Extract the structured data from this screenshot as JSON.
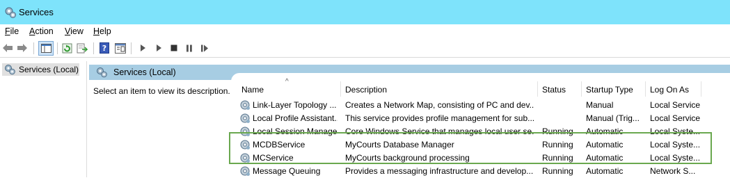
{
  "window": {
    "title": "Services"
  },
  "menu": [
    {
      "key": "file",
      "label": "File"
    },
    {
      "key": "action",
      "label": "Action"
    },
    {
      "key": "view",
      "label": "View"
    },
    {
      "key": "help",
      "label": "Help"
    }
  ],
  "tree": {
    "selected_label": "Services (Local)"
  },
  "panel": {
    "title": "Services (Local)",
    "description_hint": "Select an item to view its description."
  },
  "columns": {
    "name": "Name",
    "description": "Description",
    "status": "Status",
    "startup_type": "Startup Type",
    "log_on_as": "Log On As"
  },
  "services": [
    {
      "name": "Link-Layer Topology ...",
      "description": "Creates a Network Map, consisting of PC and dev...",
      "status": "",
      "startup_type": "Manual",
      "log_on_as": "Local Service"
    },
    {
      "name": "Local Profile Assistant...",
      "description": "This service provides profile management for sub...",
      "status": "",
      "startup_type": "Manual (Trig...",
      "log_on_as": "Local Service"
    },
    {
      "name": "Local Session Manager",
      "description": "Core Windows Service that manages local user se...",
      "status": "Running",
      "startup_type": "Automatic",
      "log_on_as": "Local Syste..."
    },
    {
      "name": "MCDBService",
      "description": "MyCourts Database Manager",
      "status": "Running",
      "startup_type": "Automatic",
      "log_on_as": "Local Syste..."
    },
    {
      "name": "MCService",
      "description": "MyCourts background processing",
      "status": "Running",
      "startup_type": "Automatic",
      "log_on_as": "Local Syste..."
    },
    {
      "name": "Message Queuing",
      "description": "Provides a messaging infrastructure and develop...",
      "status": "Running",
      "startup_type": "Automatic",
      "log_on_as": "Network S..."
    }
  ],
  "colors": {
    "titlebar": "#7ee3fb",
    "panel_header": "#a7cde3",
    "highlight_border": "#6aa84f"
  },
  "icons": {
    "app": "services-gear-icon",
    "back": "back-arrow-icon",
    "forward": "forward-arrow-icon",
    "console_tree": "console-tree-icon",
    "refresh": "refresh-icon",
    "export": "export-list-icon",
    "help": "help-icon",
    "properties": "properties-icon",
    "start": "start-service-icon",
    "start_alt": "start-service-alt-icon",
    "stop": "stop-service-icon",
    "pause": "pause-service-icon",
    "restart": "restart-service-icon"
  }
}
